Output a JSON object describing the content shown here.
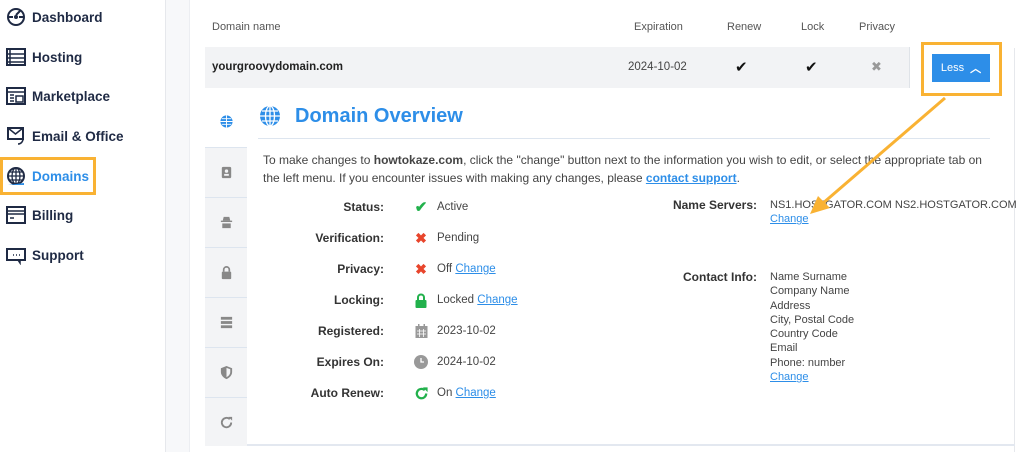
{
  "sidebar": {
    "items": [
      {
        "label": "Dashboard",
        "icon": "dashboard-icon"
      },
      {
        "label": "Hosting",
        "icon": "server-icon"
      },
      {
        "label": "Marketplace",
        "icon": "marketplace-icon"
      },
      {
        "label": "Email & Office",
        "icon": "email-icon"
      },
      {
        "label": "Domains",
        "icon": "globe-icon",
        "active": true
      },
      {
        "label": "Billing",
        "icon": "billing-icon"
      },
      {
        "label": "Support",
        "icon": "support-icon"
      }
    ]
  },
  "table": {
    "headers": {
      "domain": "Domain name",
      "expiration": "Expiration",
      "renew": "Renew",
      "lock": "Lock",
      "privacy": "Privacy"
    },
    "row": {
      "domain": "yourgroovydomain.com",
      "expiration": "2024-10-02",
      "renew": "✔",
      "lock": "✔",
      "privacy": "✖"
    },
    "less_label": "Less"
  },
  "overview": {
    "title": "Domain Overview",
    "intro_pre": "To make changes to ",
    "intro_domain": "howtokaze.com",
    "intro_mid": ", click the \"change\" button next to the information you wish to edit, or select the appropriate tab on the left menu. If you encounter issues with making any changes, please ",
    "intro_link": "contact support",
    "intro_end": ".",
    "fields": [
      {
        "label": "Status:",
        "value": "Active",
        "icon": "check-icon",
        "change": null
      },
      {
        "label": "Verification:",
        "value": "Pending",
        "icon": "x-icon",
        "change": null
      },
      {
        "label": "Privacy:",
        "value": "Off",
        "icon": "x-icon",
        "change": "Change"
      },
      {
        "label": "Locking:",
        "value": "Locked",
        "icon": "lock-icon",
        "change": "Change"
      },
      {
        "label": "Registered:",
        "value": "2023-10-02",
        "icon": "calendar-icon",
        "change": null
      },
      {
        "label": "Expires On:",
        "value": "2024-10-02",
        "icon": "clock-icon",
        "change": null
      },
      {
        "label": "Auto Renew:",
        "value": "On",
        "icon": "refresh-icon",
        "change": "Change"
      }
    ],
    "name_servers": {
      "label": "Name Servers:",
      "value": "NS1.HOSTGATOR.COM NS2.HOSTGATOR.COM",
      "change": "Change"
    },
    "contact": {
      "label": "Contact Info:",
      "lines": [
        "Name Surname",
        "Company Name",
        "Address",
        "City, Postal Code",
        "Country Code",
        "Email",
        "Phone: number"
      ],
      "change": "Change"
    }
  },
  "colors": {
    "accent": "#2d8ee8",
    "highlight": "#f9b233",
    "green": "#22b14c",
    "red": "#e8452c"
  }
}
